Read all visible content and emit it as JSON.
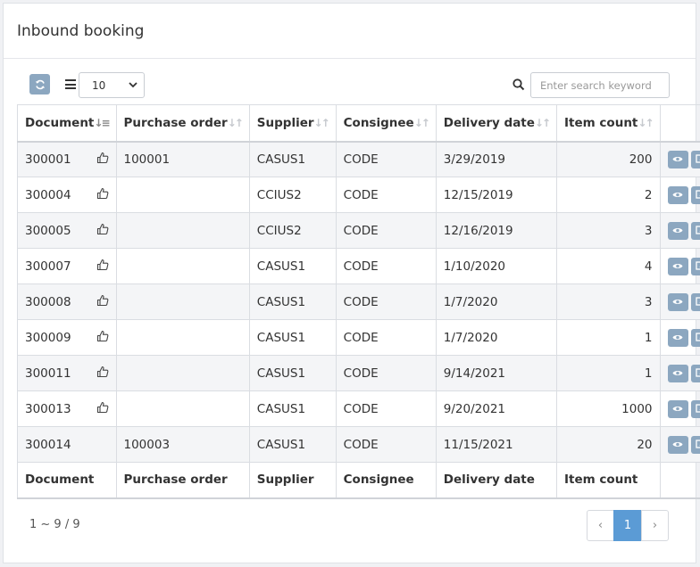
{
  "panel": {
    "title": "Inbound booking"
  },
  "toolbar": {
    "page_size": "10",
    "search_placeholder": "Enter search keyword"
  },
  "table": {
    "columns": [
      "Document",
      "Purchase order",
      "Supplier",
      "Consignee",
      "Delivery date",
      "Item count"
    ],
    "rows": [
      {
        "document": "300001",
        "po": "100001",
        "supplier": "CASUS1",
        "consignee": "CODE",
        "date": "3/29/2019",
        "count": "200",
        "thumb": true
      },
      {
        "document": "300004",
        "po": "",
        "supplier": "CCIUS2",
        "consignee": "CODE",
        "date": "12/15/2019",
        "count": "2",
        "thumb": true
      },
      {
        "document": "300005",
        "po": "",
        "supplier": "CCIUS2",
        "consignee": "CODE",
        "date": "12/16/2019",
        "count": "3",
        "thumb": true
      },
      {
        "document": "300007",
        "po": "",
        "supplier": "CASUS1",
        "consignee": "CODE",
        "date": "1/10/2020",
        "count": "4",
        "thumb": true
      },
      {
        "document": "300008",
        "po": "",
        "supplier": "CASUS1",
        "consignee": "CODE",
        "date": "1/7/2020",
        "count": "3",
        "thumb": true
      },
      {
        "document": "300009",
        "po": "",
        "supplier": "CASUS1",
        "consignee": "CODE",
        "date": "1/7/2020",
        "count": "1",
        "thumb": true
      },
      {
        "document": "300011",
        "po": "",
        "supplier": "CASUS1",
        "consignee": "CODE",
        "date": "9/14/2021",
        "count": "1",
        "thumb": true
      },
      {
        "document": "300013",
        "po": "",
        "supplier": "CASUS1",
        "consignee": "CODE",
        "date": "9/20/2021",
        "count": "1000",
        "thumb": true
      },
      {
        "document": "300014",
        "po": "100003",
        "supplier": "CASUS1",
        "consignee": "CODE",
        "date": "11/15/2021",
        "count": "20",
        "thumb": false
      }
    ]
  },
  "pagination": {
    "info": "1 ~ 9 / 9",
    "prev": "‹",
    "current": "1",
    "next": "›"
  },
  "colors": {
    "action_button": "#8ca7c0",
    "active_page": "#5b9bd5"
  }
}
